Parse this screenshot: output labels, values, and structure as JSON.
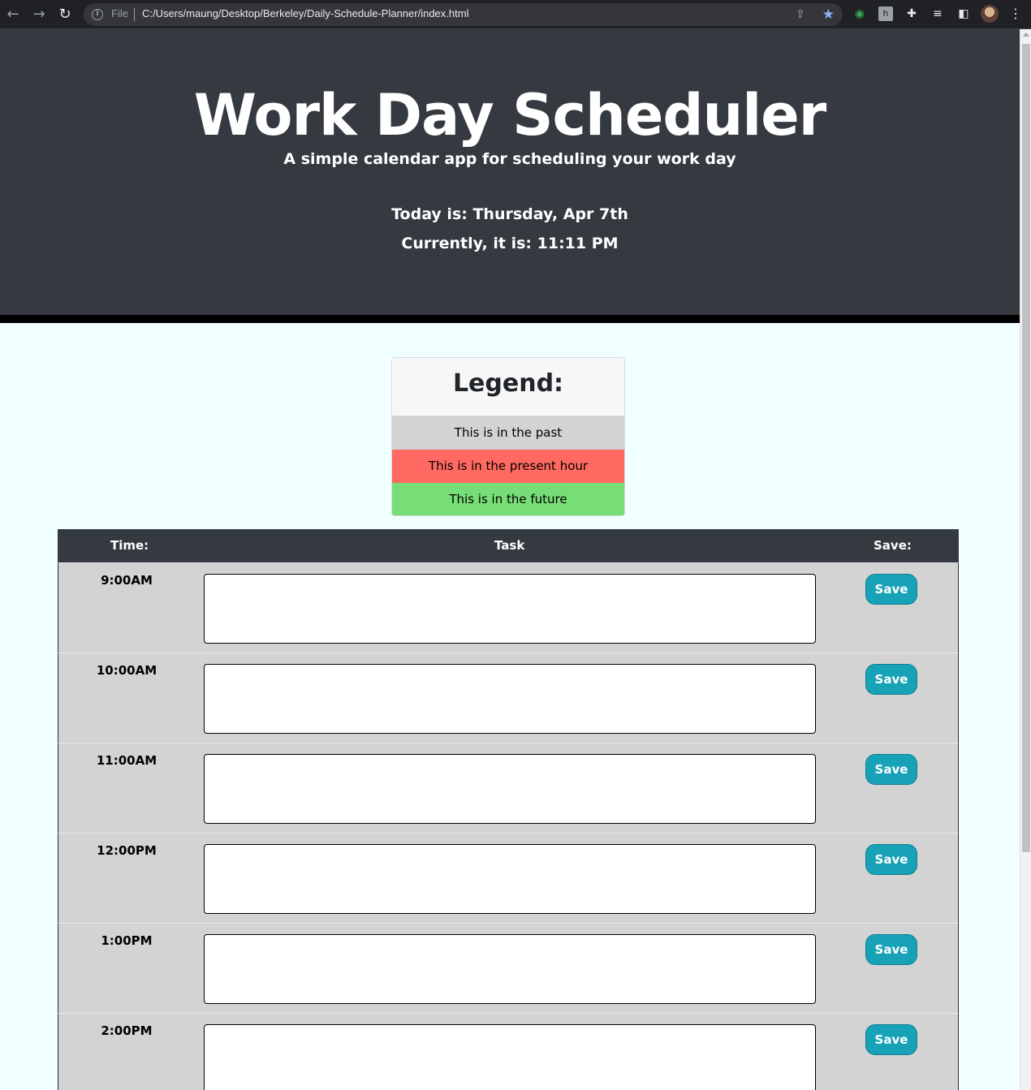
{
  "browser": {
    "scheme": "File",
    "url": "C:/Users/maung/Desktop/Berkeley/Daily-Schedule-Planner/index.html"
  },
  "header": {
    "title": "Work Day Scheduler",
    "subtitle": "A simple calendar app for scheduling your work day",
    "date_text": "Today is: Thursday, Apr 7th",
    "time_text": "Currently, it is: 11:11 PM"
  },
  "legend": {
    "title": "Legend:",
    "past": "This is in the past",
    "present": "This is in the present hour",
    "future": "This is in the future",
    "colors": {
      "past": "#d3d3d3",
      "present": "#ff6961",
      "future": "#77dd77"
    }
  },
  "table": {
    "headers": {
      "time": "Time:",
      "task": "Task",
      "save": "Save:"
    },
    "rows": [
      {
        "hour": "9:00AM",
        "task": "",
        "save_label": "Save"
      },
      {
        "hour": "10:00AM",
        "task": "",
        "save_label": "Save"
      },
      {
        "hour": "11:00AM",
        "task": "",
        "save_label": "Save"
      },
      {
        "hour": "12:00PM",
        "task": "",
        "save_label": "Save"
      },
      {
        "hour": "1:00PM",
        "task": "",
        "save_label": "Save"
      },
      {
        "hour": "2:00PM",
        "task": "",
        "save_label": "Save"
      }
    ]
  },
  "colors": {
    "header_bg": "#343a40",
    "page_bg": "#f0ffff",
    "save_button": "#17a2b8"
  }
}
